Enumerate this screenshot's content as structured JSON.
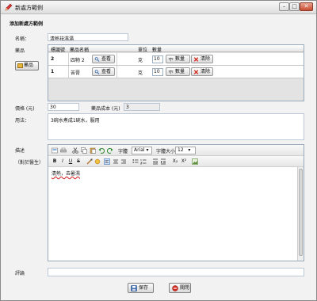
{
  "window": {
    "title": "新處方範例",
    "min": "–",
    "max": "□",
    "close": "✕"
  },
  "section_title": "添加新處方範例",
  "labels": {
    "name": "名稱：",
    "herbs": "藥品",
    "price": "價格 (元)",
    "herb_cost": "藥品成本 (元)",
    "usage": "用法：",
    "description": "描述",
    "doctor": "（對於醫生）",
    "comment": "評論"
  },
  "fields": {
    "name": "清熱祛濕湯",
    "price": "30",
    "herb_cost": "3",
    "usage": "3碗水煮成1碗水，服用",
    "comment": ""
  },
  "herb_button": "藥品",
  "grid": {
    "headers": [
      "標識號",
      "藥品名稱",
      "",
      "單位",
      "數量",
      ""
    ],
    "rows": [
      {
        "id": "2",
        "name": "四物 2",
        "view": "查看",
        "unit": "克",
        "qty": "10",
        "qty_btn": "數量",
        "clear": "清除"
      },
      {
        "id": "1",
        "name": "苦膏",
        "view": "查看",
        "unit": "克",
        "qty": "10",
        "qty_btn": "數量",
        "clear": "清除"
      }
    ]
  },
  "editor": {
    "font_label": "字體",
    "font_value": "Arial",
    "size_label": "字體大小",
    "size_value": "12",
    "bold": "B",
    "italic": "I",
    "underline": "U",
    "strike": "S",
    "sub": "X₂",
    "sup": "X²",
    "content": "清熱，去暑濕"
  },
  "buttons": {
    "save": "保存",
    "close": "關閉"
  },
  "colors": {
    "accent_border": "#9aa9ba",
    "clear_red": "#d22b20",
    "save_blue": "#3b6fb6"
  }
}
